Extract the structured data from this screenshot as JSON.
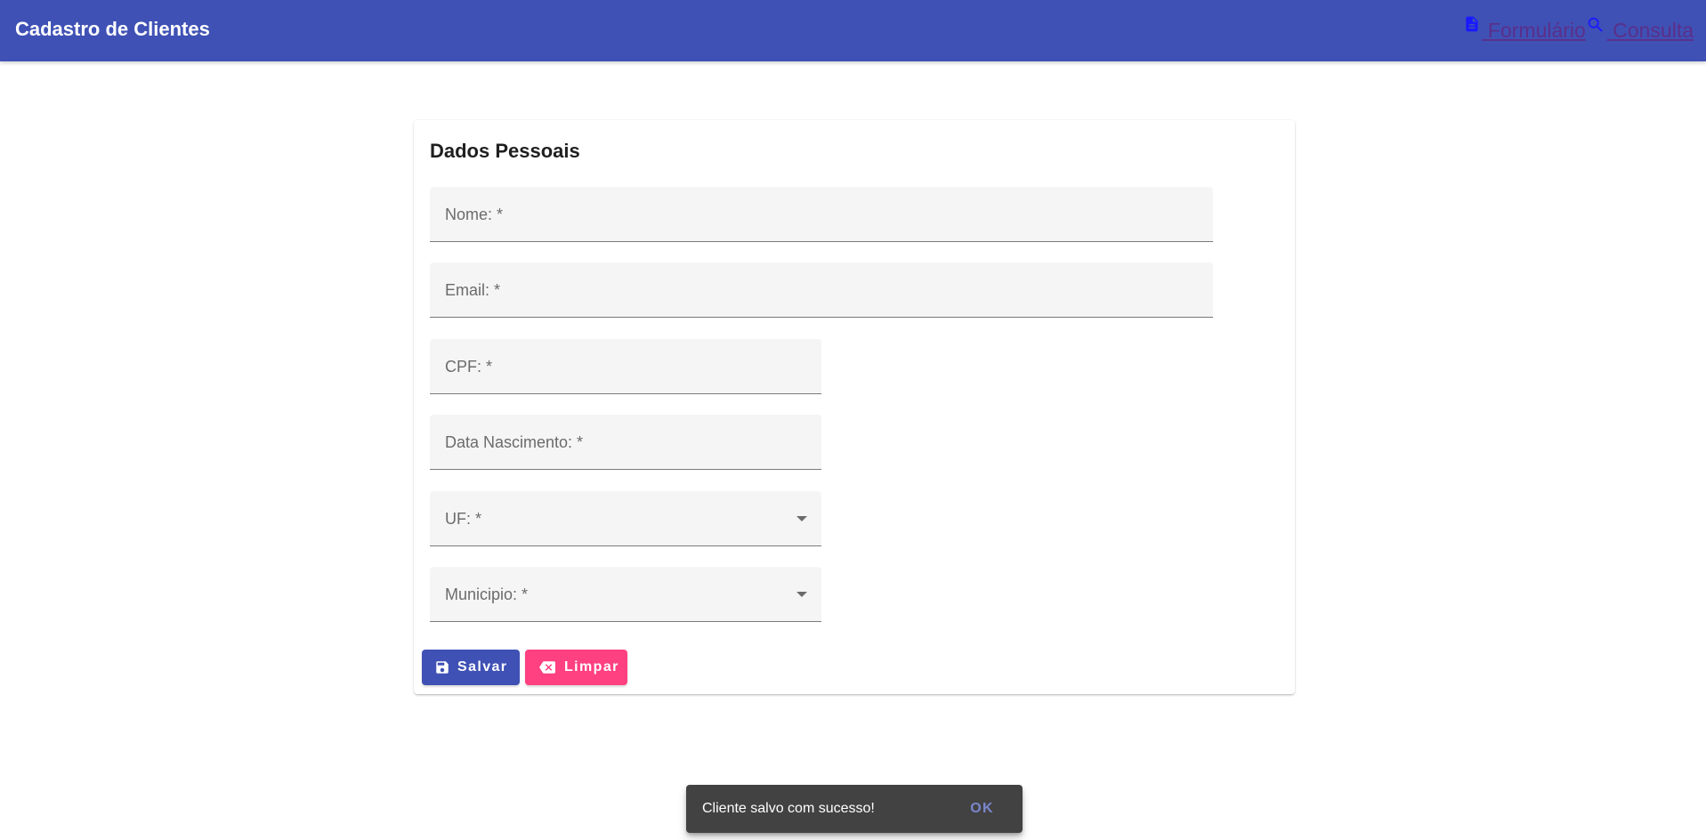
{
  "toolbar": {
    "title": "Cadastro de Clientes",
    "background": "#3f51b5",
    "nav": [
      {
        "label": "Formulário",
        "icon": "description-icon"
      },
      {
        "label": "Consulta",
        "icon": "search-icon"
      }
    ]
  },
  "form": {
    "section_title": "Dados Pessoais",
    "fields": {
      "nome": {
        "placeholder": "Nome: *",
        "value": ""
      },
      "email": {
        "placeholder": "Email: *",
        "value": ""
      },
      "cpf": {
        "placeholder": "CPF: *",
        "value": ""
      },
      "data_nascimento": {
        "placeholder": "Data Nascimento: *",
        "value": ""
      },
      "uf": {
        "placeholder": "UF: *",
        "value": ""
      },
      "municipio": {
        "placeholder": "Municipio: *",
        "value": ""
      }
    },
    "buttons": {
      "save": {
        "label": "Salvar",
        "icon": "save-icon",
        "color": "#3f51b5"
      },
      "clear": {
        "label": "Limpar",
        "icon": "backspace-icon",
        "color": "#ff4081"
      }
    }
  },
  "snackbar": {
    "message": "Cliente salvo com sucesso!",
    "action": "OK",
    "action_color": "#7986cb"
  }
}
